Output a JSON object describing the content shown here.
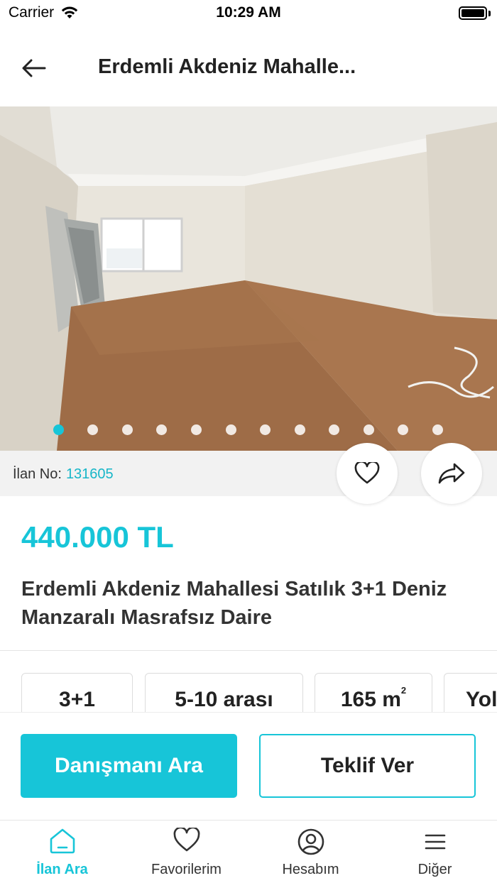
{
  "status_bar": {
    "carrier": "Carrier",
    "time": "10:29 AM"
  },
  "nav": {
    "back_icon": "arrow-left-icon",
    "title": "Erdemli Akdeniz Mahalle..."
  },
  "photo": {
    "description_icon": "room-photo",
    "page_count": 12,
    "active_page": 1
  },
  "listing": {
    "ilan_no_label": "İlan No:",
    "ilan_no_value": "131605",
    "price": "440.000 TL",
    "title": "Erdemli Akdeniz Mahallesi Satılık 3+1 Deniz Manzaralı Masrafsız Daire"
  },
  "features": [
    {
      "value": "3+1"
    },
    {
      "value": "5-10 arası"
    },
    {
      "value": "165 m",
      "sup": "2"
    },
    {
      "value": "Yol"
    }
  ],
  "actions": {
    "call": "Danışmanı Ara",
    "offer": "Teklif Ver"
  },
  "tabs": [
    {
      "label": "İlan Ara",
      "icon": "home-icon",
      "active": true
    },
    {
      "label": "Favorilerim",
      "icon": "heart-icon",
      "active": false
    },
    {
      "label": "Hesabım",
      "icon": "user-circle-icon",
      "active": false
    },
    {
      "label": "Diğer",
      "icon": "menu-icon",
      "active": false
    }
  ],
  "colors": {
    "accent": "#17c5d8",
    "text": "#222222",
    "strip": "#f2f2f2"
  }
}
